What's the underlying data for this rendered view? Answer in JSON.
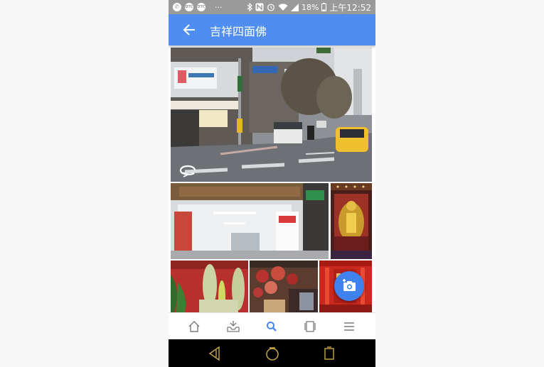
{
  "status_bar": {
    "battery": "18%",
    "time": "上午12:52",
    "left_icons": [
      "whatsapp-icon",
      "dtc-icon",
      "dtc-icon",
      "more-icon"
    ],
    "right_icons": [
      "bluetooth-icon",
      "nfc-icon",
      "alarm-icon",
      "wifi-icon",
      "signal-icon",
      "battery-icon"
    ],
    "badge_text": "DTC"
  },
  "app_bar": {
    "back_icon": "arrow-back-icon",
    "title": "吉祥四面佛"
  },
  "photos": {
    "count": 6,
    "items": [
      "street-view-photo",
      "temple-entrance-photo",
      "buddha-statue-photo",
      "flowers-photo",
      "flower-offerings-photo",
      "red-altar-photo"
    ],
    "street_view_icon": "rotate-360-icon"
  },
  "fab": {
    "icon": "add-photo-icon"
  },
  "bottom_nav": {
    "items": [
      {
        "icon": "home-icon",
        "active": false
      },
      {
        "icon": "inbox-icon",
        "active": false
      },
      {
        "icon": "search-icon",
        "active": true
      },
      {
        "icon": "cards-icon",
        "active": false
      },
      {
        "icon": "menu-icon",
        "active": false
      }
    ],
    "active_color": "#4a86e8",
    "inactive_color": "#7a7a7a"
  },
  "system_nav": {
    "items": [
      "back-icon",
      "home-circle-icon",
      "recents-icon"
    ],
    "color": "#c9a84a"
  },
  "colors": {
    "app_bar": "#4f8ef0",
    "fab": "#3f82ee",
    "status_bar": "#9a9a9a"
  }
}
